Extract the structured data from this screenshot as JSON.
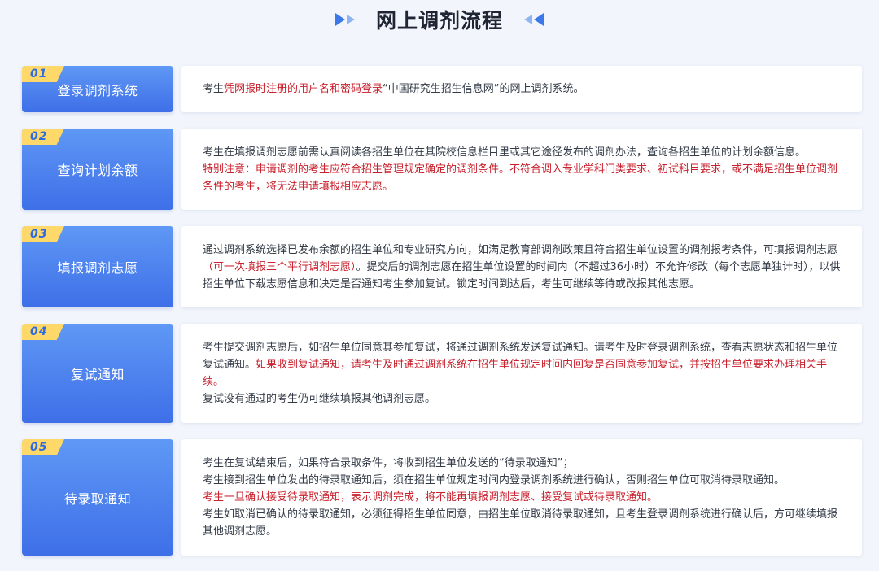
{
  "title": "网上调剂流程",
  "colors": {
    "accent_blue": "#3e6fe8",
    "tab_yellow": "#ffd86a",
    "emphasis_red": "#c8202c"
  },
  "steps": [
    {
      "num": "01",
      "label": "登录调剂系统",
      "lines": [
        [
          {
            "t": "考生",
            "red": false
          },
          {
            "t": "凭网报时注册的用户名和密码登录",
            "red": true
          },
          {
            "t": "“中国研究生招生信息网”的网上调剂系统。",
            "red": false
          }
        ]
      ]
    },
    {
      "num": "02",
      "label": "查询计划余额",
      "lines": [
        [
          {
            "t": "考生在填报调剂志愿前需认真阅读各招生单位在其院校信息栏目里或其它途径发布的调剂办法，查询各招生单位的计划余额信息。",
            "red": false
          }
        ],
        [
          {
            "t": "特别注意：申请调剂的考生应符合招生管理规定确定的调剂条件。不符合调入专业学科门类要求、初试科目要求，或不满足招生单位调剂条件的考生，将无法申请填报相应志愿。",
            "red": true
          }
        ]
      ]
    },
    {
      "num": "03",
      "label": "填报调剂志愿",
      "lines": [
        [
          {
            "t": "通过调剂系统选择已发布余额的招生单位和专业研究方向，如满足教育部调剂政策且符合招生单位设置的调剂报考条件，可填报调剂志愿",
            "red": false
          },
          {
            "t": "（可一次填报三个平行调剂志愿）",
            "red": true
          },
          {
            "t": "。提交后的调剂志愿在招生单位设置的时间内（不超过36小时）不允许修改（每个志愿单独计时），以供招生单位下载志愿信息和决定是否通知考生参加复试。锁定时间到达后，考生可继续等待或改报其他志愿。",
            "red": false
          }
        ]
      ]
    },
    {
      "num": "04",
      "label": "复试通知",
      "lines": [
        [
          {
            "t": "考生提交调剂志愿后，如招生单位同意其参加复试，将通过调剂系统发送复试通知。请考生及时登录调剂系统，查看志愿状态和招生单位复试通知。",
            "red": false
          },
          {
            "t": "如果收到复试通知，请考生及时通过调剂系统在招生单位规定时间内回复是否同意参加复试，并按招生单位要求办理相关手续。",
            "red": true
          }
        ],
        [
          {
            "t": "复试没有通过的考生仍可继续填报其他调剂志愿。",
            "red": false
          }
        ]
      ]
    },
    {
      "num": "05",
      "label": "待录取通知",
      "lines": [
        [
          {
            "t": "考生在复试结束后，如果符合录取条件，将收到招生单位发送的“待录取通知”；",
            "red": false
          }
        ],
        [
          {
            "t": "考生接到招生单位发出的待录取通知后，须在招生单位规定时间内登录调剂系统进行确认，否则招生单位可取消待录取通知。",
            "red": false
          }
        ],
        [
          {
            "t": "考生一旦确认接受待录取通知，表示调剂完成，将不能再填报调剂志愿、接受复试或待录取通知。",
            "red": true
          }
        ],
        [
          {
            "t": "考生如取消已确认的待录取通知，必须征得招生单位同意，由招生单位取消待录取通知，且考生登录调剂系统进行确认后，方可继续填报其他调剂志愿。",
            "red": false
          }
        ]
      ]
    }
  ]
}
